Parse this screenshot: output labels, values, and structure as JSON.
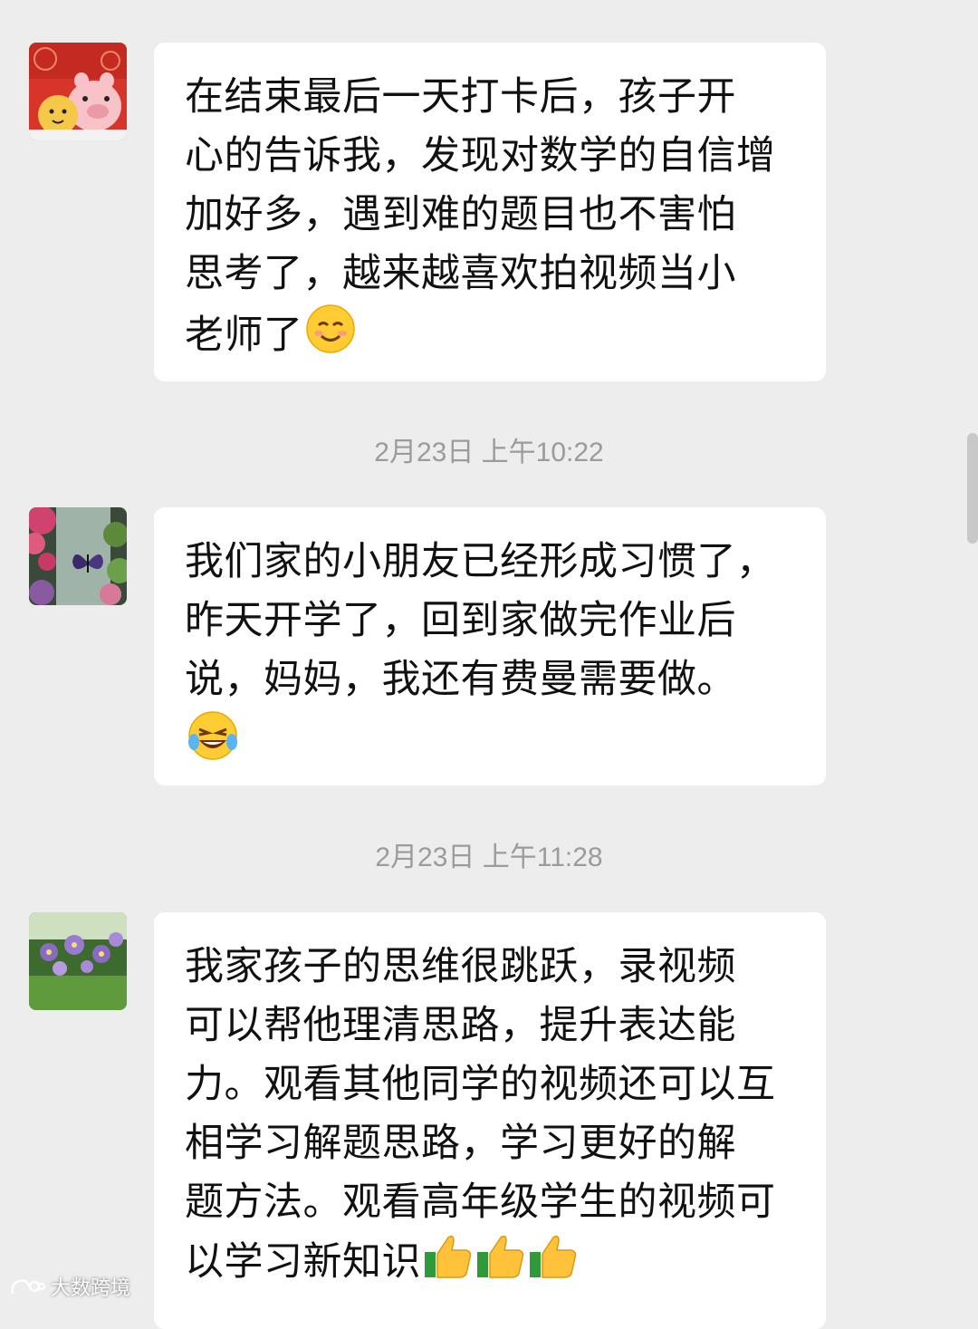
{
  "messages": [
    {
      "avatar_desc": "cartoon-pig-avatar",
      "lines": [
        "在结束最后一天打卡后，孩子开",
        "心的告诉我，发现对数学的自信增",
        "加好多，遇到难的题目也不害怕",
        "思考了，越来越喜欢拍视频当小",
        "老师了"
      ],
      "emoji": [
        "smile-emoji"
      ]
    },
    {
      "avatar_desc": "butterfly-flowers-avatar",
      "lines": [
        "我们家的小朋友已经形成习惯了，",
        "昨天开学了，回到家做完作业后",
        "说，妈妈，我还有费曼需要做。",
        ""
      ],
      "emoji": [
        "laughing-tears-emoji"
      ]
    },
    {
      "avatar_desc": "purple-flowers-avatar",
      "lines": [
        "我家孩子的思维很跳跃，录视频",
        "可以帮他理清思路，提升表达能",
        "力。观看其他同学的视频还可以互",
        "相学习解题思路，学习更好的解",
        "题方法。观看高年级学生的视频可",
        "以学习新知识"
      ],
      "emoji": [
        "thumbs-up-emoji",
        "thumbs-up-emoji",
        "thumbs-up-emoji"
      ]
    }
  ],
  "timestamps": [
    "2月23日 上午10:22",
    "2月23日 上午11:28"
  ],
  "watermark": "大数跨境",
  "colors": {
    "background": "#ededed",
    "bubble": "#ffffff",
    "timestamp": "#9b9b9b"
  }
}
